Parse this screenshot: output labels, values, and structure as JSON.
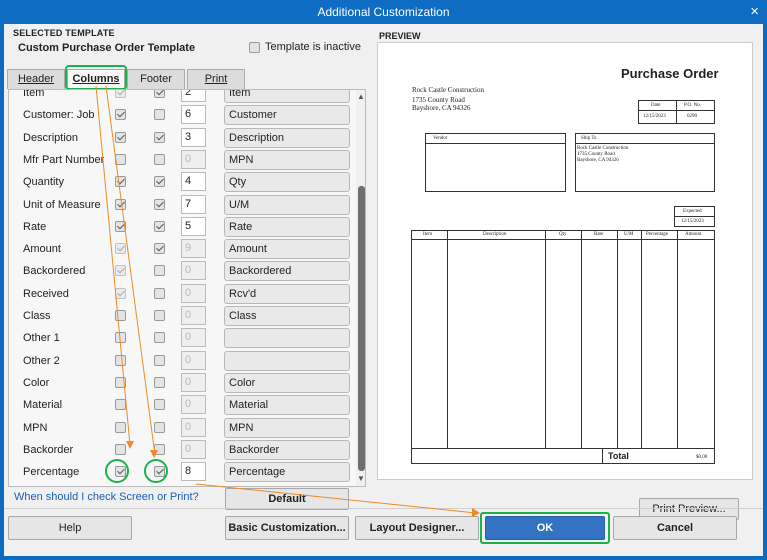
{
  "window": {
    "title": "Additional Customization",
    "close_glyph": "×"
  },
  "selected_template": {
    "section_label": "SELECTED TEMPLATE",
    "name": "Custom Purchase Order Template",
    "inactive_label": "Template is inactive"
  },
  "tabs": [
    {
      "label": "Header",
      "active": false
    },
    {
      "label": "Columns",
      "active": true
    },
    {
      "label": "Footer",
      "active": false
    },
    {
      "label": "Print",
      "active": false
    }
  ],
  "column_rows": [
    {
      "label": "Item",
      "screen": true,
      "print": true,
      "order": "2",
      "title": "Item",
      "screen_enabled": false,
      "print_enabled": true,
      "order_enabled": true
    },
    {
      "label": "Customer: Job",
      "screen": true,
      "print": false,
      "order": "6",
      "title": "Customer",
      "screen_enabled": true,
      "print_enabled": true,
      "order_enabled": true
    },
    {
      "label": "Description",
      "screen": true,
      "print": true,
      "order": "3",
      "title": "Description",
      "screen_enabled": true,
      "print_enabled": true,
      "order_enabled": true
    },
    {
      "label": "Mfr Part Number",
      "screen": false,
      "print": false,
      "order": "0",
      "title": "MPN",
      "screen_enabled": true,
      "print_enabled": true,
      "order_enabled": false
    },
    {
      "label": "Quantity",
      "screen": true,
      "print": true,
      "order": "4",
      "title": "Qty",
      "screen_enabled": true,
      "print_enabled": true,
      "order_enabled": true
    },
    {
      "label": "Unit of Measure",
      "screen": true,
      "print": true,
      "order": "7",
      "title": "U/M",
      "screen_enabled": true,
      "print_enabled": true,
      "order_enabled": true
    },
    {
      "label": "Rate",
      "screen": true,
      "print": true,
      "order": "5",
      "title": "Rate",
      "screen_enabled": true,
      "print_enabled": true,
      "order_enabled": true
    },
    {
      "label": "Amount",
      "screen": true,
      "print": true,
      "order": "9",
      "title": "Amount",
      "screen_enabled": false,
      "print_enabled": true,
      "order_enabled": false
    },
    {
      "label": "Backordered",
      "screen": true,
      "print": false,
      "order": "0",
      "title": "Backordered",
      "screen_enabled": false,
      "print_enabled": true,
      "order_enabled": false
    },
    {
      "label": "Received",
      "screen": true,
      "print": false,
      "order": "0",
      "title": "Rcv'd",
      "screen_enabled": false,
      "print_enabled": true,
      "order_enabled": false
    },
    {
      "label": "Class",
      "screen": false,
      "print": false,
      "order": "0",
      "title": "Class",
      "screen_enabled": true,
      "print_enabled": true,
      "order_enabled": false
    },
    {
      "label": "Other 1",
      "screen": false,
      "print": false,
      "order": "0",
      "title": "",
      "screen_enabled": true,
      "print_enabled": true,
      "order_enabled": false
    },
    {
      "label": "Other 2",
      "screen": false,
      "print": false,
      "order": "0",
      "title": "",
      "screen_enabled": true,
      "print_enabled": true,
      "order_enabled": false
    },
    {
      "label": "Color",
      "screen": false,
      "print": false,
      "order": "0",
      "title": "Color",
      "screen_enabled": true,
      "print_enabled": true,
      "order_enabled": false
    },
    {
      "label": "Material",
      "screen": false,
      "print": false,
      "order": "0",
      "title": "Material",
      "screen_enabled": true,
      "print_enabled": true,
      "order_enabled": false
    },
    {
      "label": "MPN",
      "screen": false,
      "print": false,
      "order": "0",
      "title": "MPN",
      "screen_enabled": true,
      "print_enabled": true,
      "order_enabled": false
    },
    {
      "label": "Backorder",
      "screen": false,
      "print": false,
      "order": "0",
      "title": "Backorder",
      "screen_enabled": true,
      "print_enabled": true,
      "order_enabled": false
    },
    {
      "label": "Percentage",
      "screen": true,
      "print": true,
      "order": "8",
      "title": "Percentage",
      "screen_enabled": true,
      "print_enabled": true,
      "order_enabled": true
    }
  ],
  "help_link": "When should I check Screen or Print?",
  "default_button": "Default",
  "preview": {
    "section_label": "PREVIEW",
    "company_lines": [
      "Rock Castle Construction",
      "1735 County Road",
      "Bayshore, CA 94326"
    ],
    "doc_title": "Purchase Order",
    "date_label": "Date",
    "po_label": "P.O. No.",
    "date_value": "12/15/2023",
    "po_value": "6290",
    "vendor_label": "Vendor",
    "ship_to_label": "Ship To",
    "ship_to_lines": [
      "Rock Castle Construction",
      "1735 County Road",
      "Bayshore, CA 94326"
    ],
    "expected_label": "Expected",
    "expected_value": "12/15/2023",
    "columns": [
      "Item",
      "Description",
      "Qty",
      "Rate",
      "U/M",
      "Percentage",
      "Amount"
    ],
    "total_label": "Total",
    "total_value": "$0.00",
    "print_preview_button": "Print Preview..."
  },
  "footer_buttons": {
    "help": "Help",
    "basic": "Basic Customization...",
    "layout": "Layout Designer...",
    "ok": "OK",
    "cancel": "Cancel"
  },
  "colors": {
    "highlight_ring": "#1bb24d",
    "annotation_arrow": "#f08a24",
    "title_bar": "#0e6cc2",
    "ok_button": "#3472c4"
  }
}
